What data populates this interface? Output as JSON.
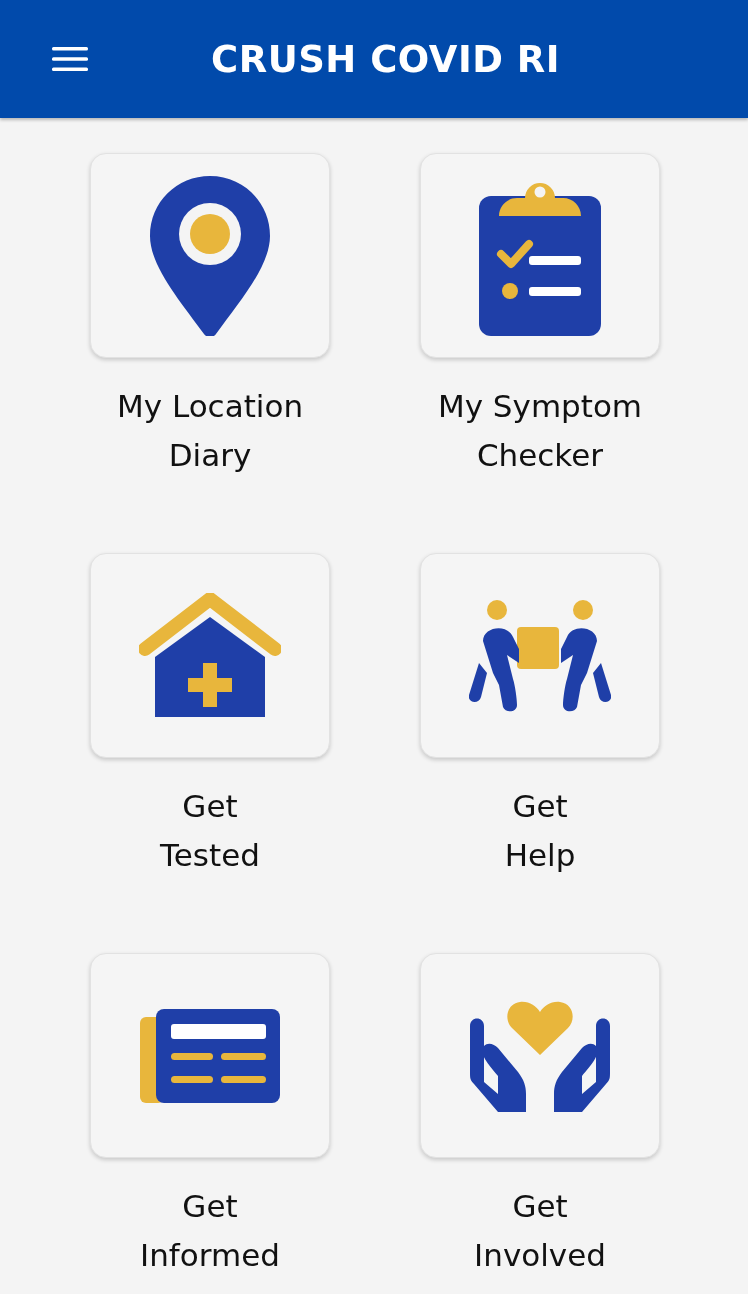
{
  "header": {
    "title": "CRUSH COVID RI"
  },
  "tiles": [
    {
      "label_lines": [
        "My Location",
        "Diary"
      ]
    },
    {
      "label_lines": [
        "My Symptom",
        "Checker"
      ]
    },
    {
      "label_lines": [
        "Get",
        "Tested"
      ]
    },
    {
      "label_lines": [
        "Get",
        "Help"
      ]
    },
    {
      "label_lines": [
        "Get",
        "Informed"
      ]
    },
    {
      "label_lines": [
        "Get",
        "Involved"
      ]
    }
  ]
}
